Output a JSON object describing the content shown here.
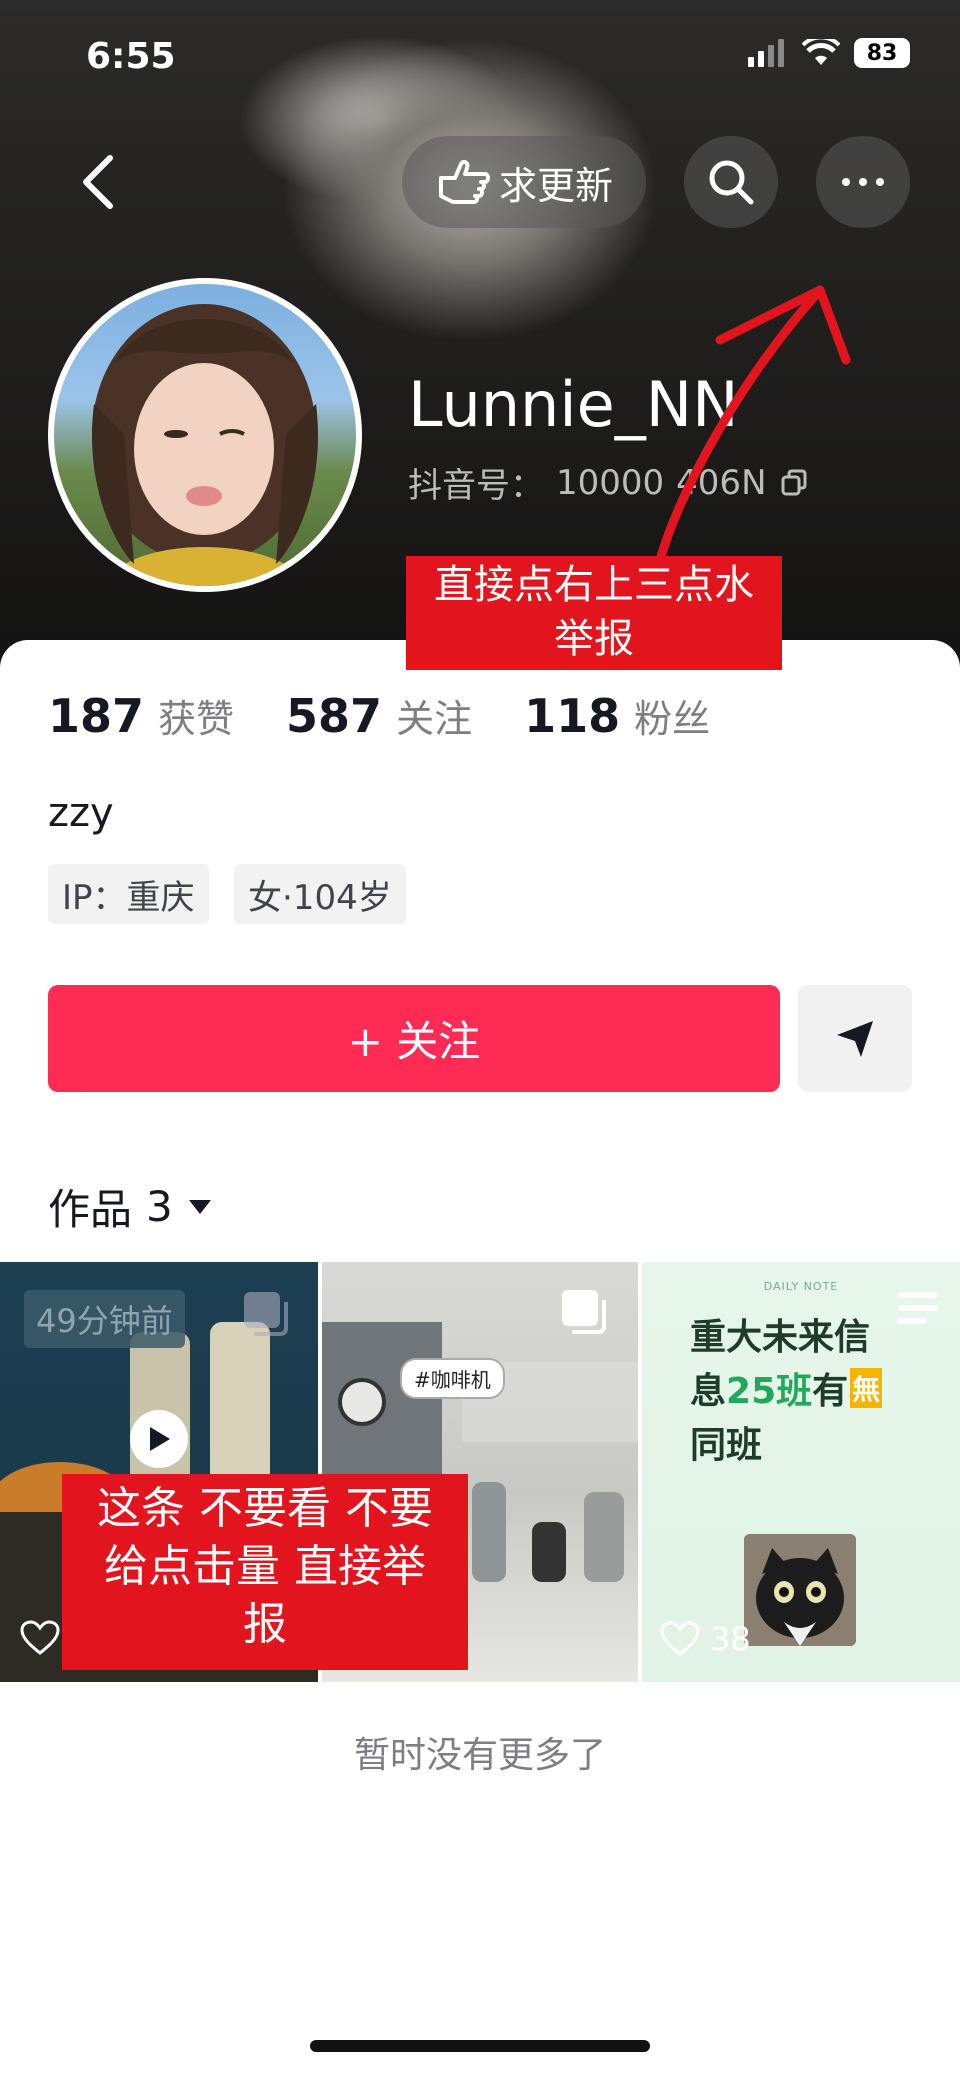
{
  "status_bar": {
    "time": "6:55",
    "battery": "83"
  },
  "header": {
    "update_request_label": "求更新"
  },
  "profile": {
    "username": "Lunnie_NN",
    "douyin_id_label": "抖音号：",
    "douyin_id_value": "10000",
    "douyin_id_tail": "406N"
  },
  "annotations": {
    "top_note_line1": "直接点右上三点水",
    "top_note_line2": "举报",
    "video_note_line1": "这条 不要看 不要",
    "video_note_line2": "给点击量 直接举",
    "video_note_line3": "报"
  },
  "stats": [
    {
      "number": "187",
      "label": "获赞"
    },
    {
      "number": "587",
      "label": "关注"
    },
    {
      "number": "118",
      "label": "粉丝"
    }
  ],
  "bio": "zzy",
  "tags": {
    "ip": "IP：重庆",
    "gender_age": "女·104岁"
  },
  "actions": {
    "follow_label": "+ 关注"
  },
  "works": {
    "label": "作品",
    "count": "3"
  },
  "grid": {
    "item1": {
      "time": "49分钟前"
    },
    "item2": {
      "tag": "#咖啡机"
    },
    "item3": {
      "small_header": "DAILY NOTE",
      "line1": "重大未来信",
      "line2a": "息",
      "line2b": "25班",
      "line2c": "有",
      "line2d": "無",
      "line3": "同班",
      "likes": "38"
    }
  },
  "footer": {
    "no_more": "暂时没有更多了"
  },
  "colors": {
    "accent": "#fe2c55",
    "annotation_red": "#e2141e"
  }
}
